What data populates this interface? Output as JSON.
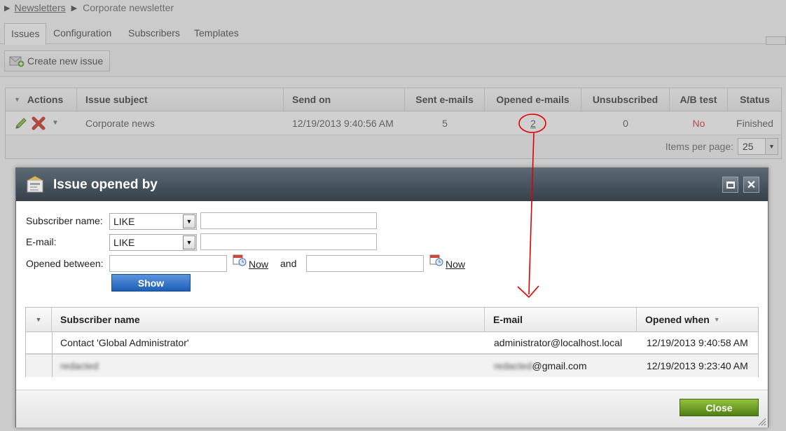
{
  "breadcrumb": {
    "root": "Newsletters",
    "current": "Corporate newsletter"
  },
  "tabs": [
    {
      "label": "Issues",
      "active": true
    },
    {
      "label": "Configuration"
    },
    {
      "label": "Subscribers"
    },
    {
      "label": "Templates"
    }
  ],
  "toolbar": {
    "create_label": "Create new issue"
  },
  "issues_table": {
    "columns": [
      "Actions",
      "Issue subject",
      "Send on",
      "Sent e-mails",
      "Opened e-mails",
      "Unsubscribed",
      "A/B test",
      "Status"
    ],
    "row": {
      "subject": "Corporate news",
      "send_on": "12/19/2013 9:40:56 AM",
      "sent": "5",
      "opened": "2",
      "unsubscribed": "0",
      "ab_test": "No",
      "status": "Finished"
    },
    "pager": {
      "label": "Items per page:",
      "value": "25"
    }
  },
  "dialog": {
    "title": "Issue opened by",
    "filter": {
      "subscriber_label": "Subscriber name:",
      "subscriber_op": "LIKE",
      "email_label": "E-mail:",
      "email_op": "LIKE",
      "opened_label": "Opened between:",
      "now_label": "Now",
      "and_label": "and",
      "show_label": "Show"
    },
    "grid": {
      "columns": [
        "Subscriber name",
        "E-mail",
        "Opened when"
      ],
      "rows": [
        {
          "name": "Contact 'Global Administrator'",
          "email": "administrator@localhost.local",
          "opened": "12/19/2013 9:40:58 AM"
        },
        {
          "name_redacted": "redacted",
          "email_redacted": "redacted",
          "email_suffix": "@gmail.com",
          "opened": "12/19/2013 9:23:40 AM"
        }
      ]
    },
    "close_label": "Close"
  },
  "colors": {
    "dialog_title": "#35404a",
    "show_button": "#1d5fb6",
    "close_button": "#4f7f12",
    "ab_test_no": "#cc3333",
    "annotation": "#e00000"
  },
  "icons": [
    "newsletter-icon",
    "edit-icon",
    "delete-icon",
    "chevron-down-icon",
    "maximize-icon",
    "close-icon",
    "calendar-icon",
    "create-issue-icon",
    "resize-grip-icon"
  ]
}
